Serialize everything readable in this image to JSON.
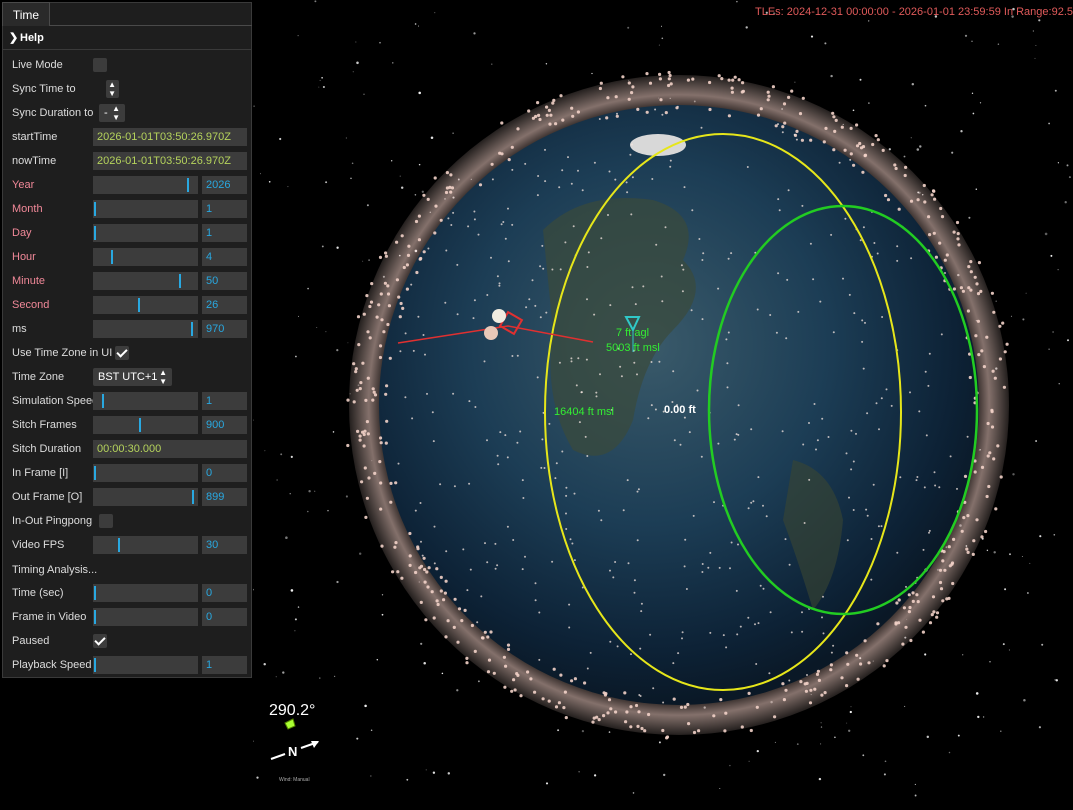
{
  "panel": {
    "tab_label": "Time",
    "help_label": "Help",
    "live_mode": {
      "label": "Live Mode",
      "checked": false
    },
    "sync_time_to": {
      "label": "Sync Time to",
      "value": ""
    },
    "sync_duration_to": {
      "label": "Sync Duration to",
      "value": "-"
    },
    "start_time": {
      "label": "startTime",
      "value": "2026-01-01T03:50:26.970Z"
    },
    "now_time": {
      "label": "nowTime",
      "value": "2026-01-01T03:50:26.970Z"
    },
    "year": {
      "label": "Year",
      "value": "2026",
      "level": 0.93
    },
    "month": {
      "label": "Month",
      "value": "1",
      "level": 0.0
    },
    "day": {
      "label": "Day",
      "value": "1",
      "level": 0.0
    },
    "hour": {
      "label": "Hour",
      "value": "4",
      "level": 0.17
    },
    "minute": {
      "label": "Minute",
      "value": "50",
      "level": 0.85
    },
    "second": {
      "label": "Second",
      "value": "26",
      "level": 0.44
    },
    "ms": {
      "label": "ms",
      "value": "970",
      "level": 0.97
    },
    "use_time_zone": {
      "label": "Use Time Zone in UI",
      "checked": true
    },
    "time_zone": {
      "label": "Time Zone",
      "value": "BST UTC+1"
    },
    "simulation_speed": {
      "label": "Simulation Speed",
      "value": "1",
      "level": 0.08
    },
    "sitch_frames": {
      "label": "Sitch Frames",
      "value": "900",
      "level": 0.45
    },
    "sitch_duration": {
      "label": "Sitch Duration",
      "value": "00:00:30.000"
    },
    "in_frame": {
      "label": "In Frame [I]",
      "value": "0",
      "level": 0.0
    },
    "out_frame": {
      "label": "Out Frame [O]",
      "value": "899",
      "level": 0.98
    },
    "in_out_pingpong": {
      "label": "In-Out Pingpong",
      "checked": false
    },
    "video_fps": {
      "label": "Video FPS",
      "value": "30",
      "level": 0.24
    },
    "timing_analysis": {
      "label": "Timing Analysis..."
    },
    "time_sec": {
      "label": "Time (sec)",
      "value": "0",
      "level": 0.0
    },
    "frame_in_video": {
      "label": "Frame in Video",
      "value": "0",
      "level": 0.0
    },
    "paused": {
      "label": "Paused",
      "checked": true
    },
    "playback_speed": {
      "label": "Playback Speed",
      "value": "1",
      "level": 0.0
    }
  },
  "scene": {
    "tle_range_text": "TLEs: 2024-12-31 00:00:00 - 2026-01-01 23:59:59   In Range:92.5",
    "labels": {
      "agl": "7 ft agl",
      "msl_small": "5003 ft msl",
      "msl_large": "16404 ft msl",
      "zero_ft": "0.00 ft"
    },
    "heading": "290.2°",
    "north_label": "N",
    "wind_label": "Wind: Manual",
    "colors": {
      "accent": "#29a8e0",
      "tle_text": "#e05a5a",
      "yellow_ring": "#e6e61a",
      "green_ring": "#22cc22",
      "label_green": "#33ee33"
    }
  }
}
